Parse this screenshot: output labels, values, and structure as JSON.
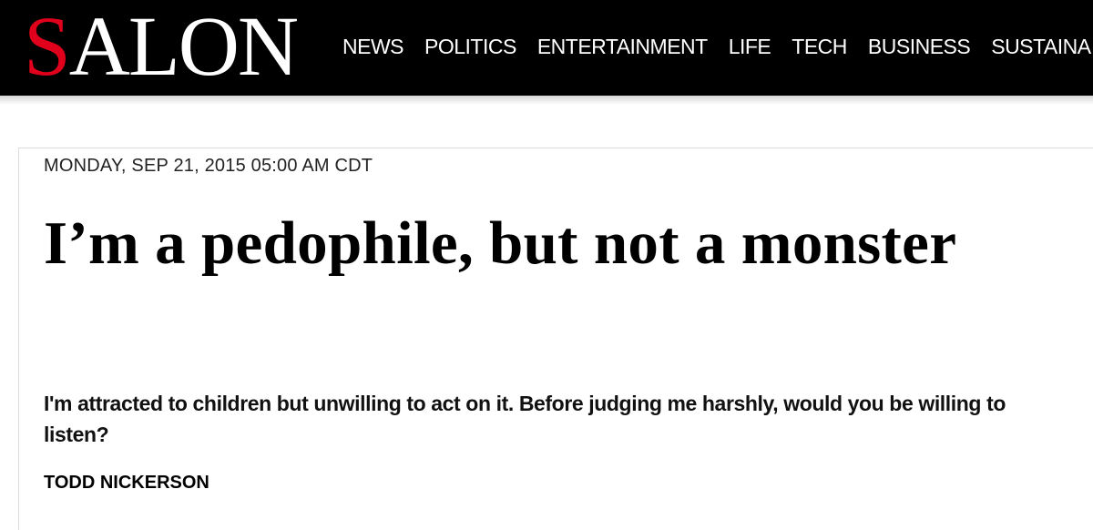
{
  "header": {
    "logo": {
      "first_letter": "S",
      "rest": "ALON"
    },
    "nav_items": [
      "NEWS",
      "POLITICS",
      "ENTERTAINMENT",
      "LIFE",
      "TECH",
      "BUSINESS",
      "SUSTAINA"
    ]
  },
  "article": {
    "dateline": "MONDAY, SEP 21, 2015 05:00 AM CDT",
    "headline": "I’m a pedophile, but not a monster",
    "dek": "I'm attracted to children but unwilling to act on it. Before judging me harshly, would you be willing to listen?",
    "byline": "TODD NICKERSON"
  },
  "colors": {
    "header_background": "#000000",
    "logo_accent": "#e0001b",
    "text": "#000000"
  }
}
